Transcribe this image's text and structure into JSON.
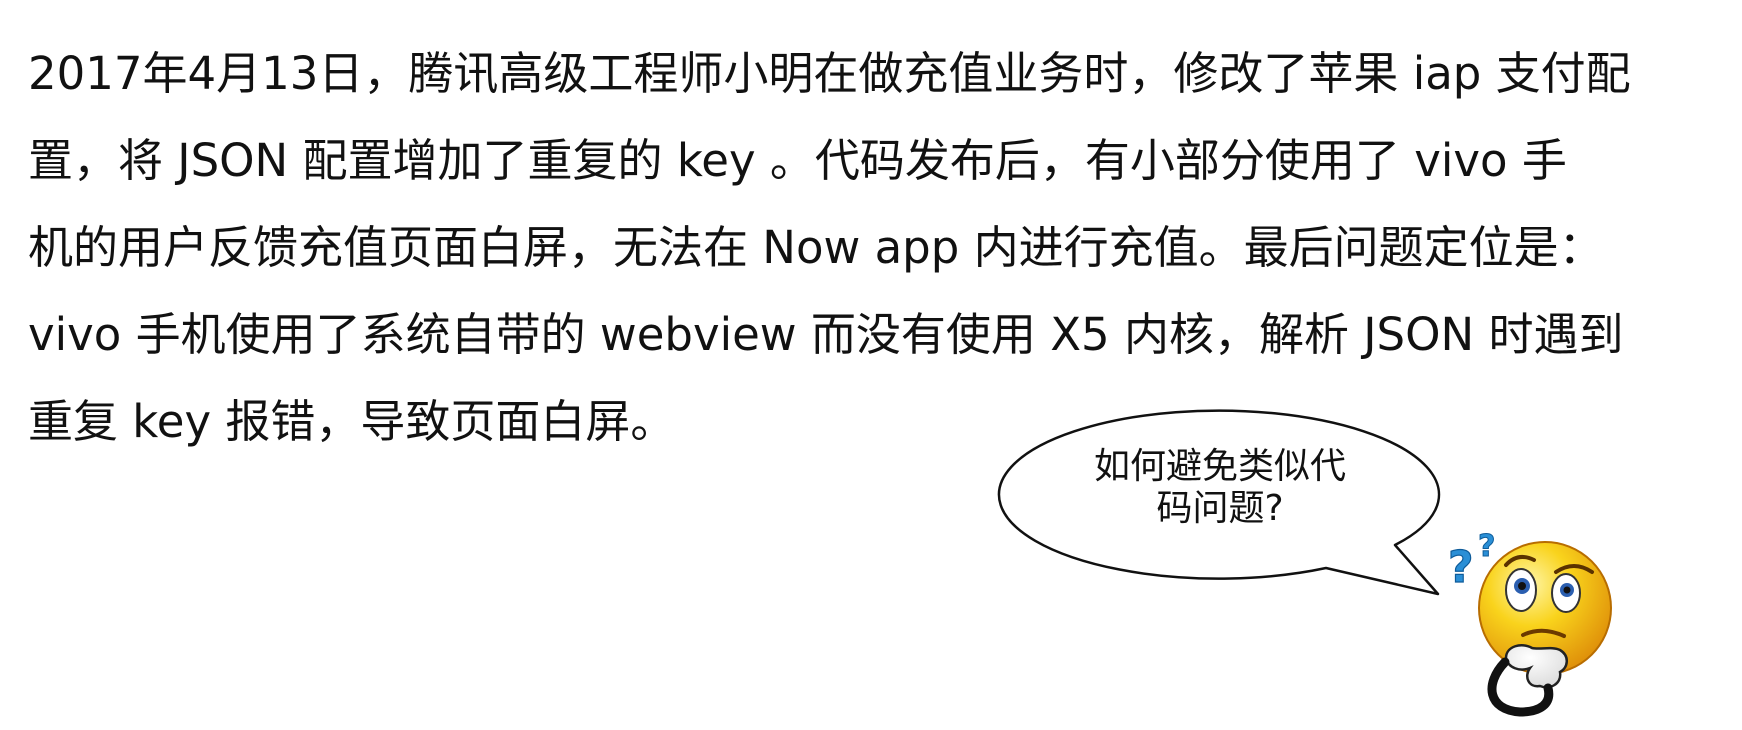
{
  "paragraph": {
    "lines": [
      "2017年4月13日，腾讯高级工程师小明在做充值业务时，修改了苹果 iap 支付配",
      "置，将 JSON 配置增加了重复的 key 。代码发布后，有小部分使用了 vivo 手",
      "机的用户反馈充值页面白屏，无法在 Now app 内进行充值。最后问题定位是：",
      "vivo 手机使用了系统自带的 webview 而没有使用 X5 内核，解析 JSON 时遇到",
      "重复 key 报错，导致页面白屏。"
    ]
  },
  "speech_bubble": {
    "lines": [
      "如何避免类似代",
      "码问题?"
    ]
  },
  "illustration": {
    "icon": "thinking-emoji-icon",
    "face_color": "#f6c512",
    "question_mark_color": "#2a8fd6"
  }
}
